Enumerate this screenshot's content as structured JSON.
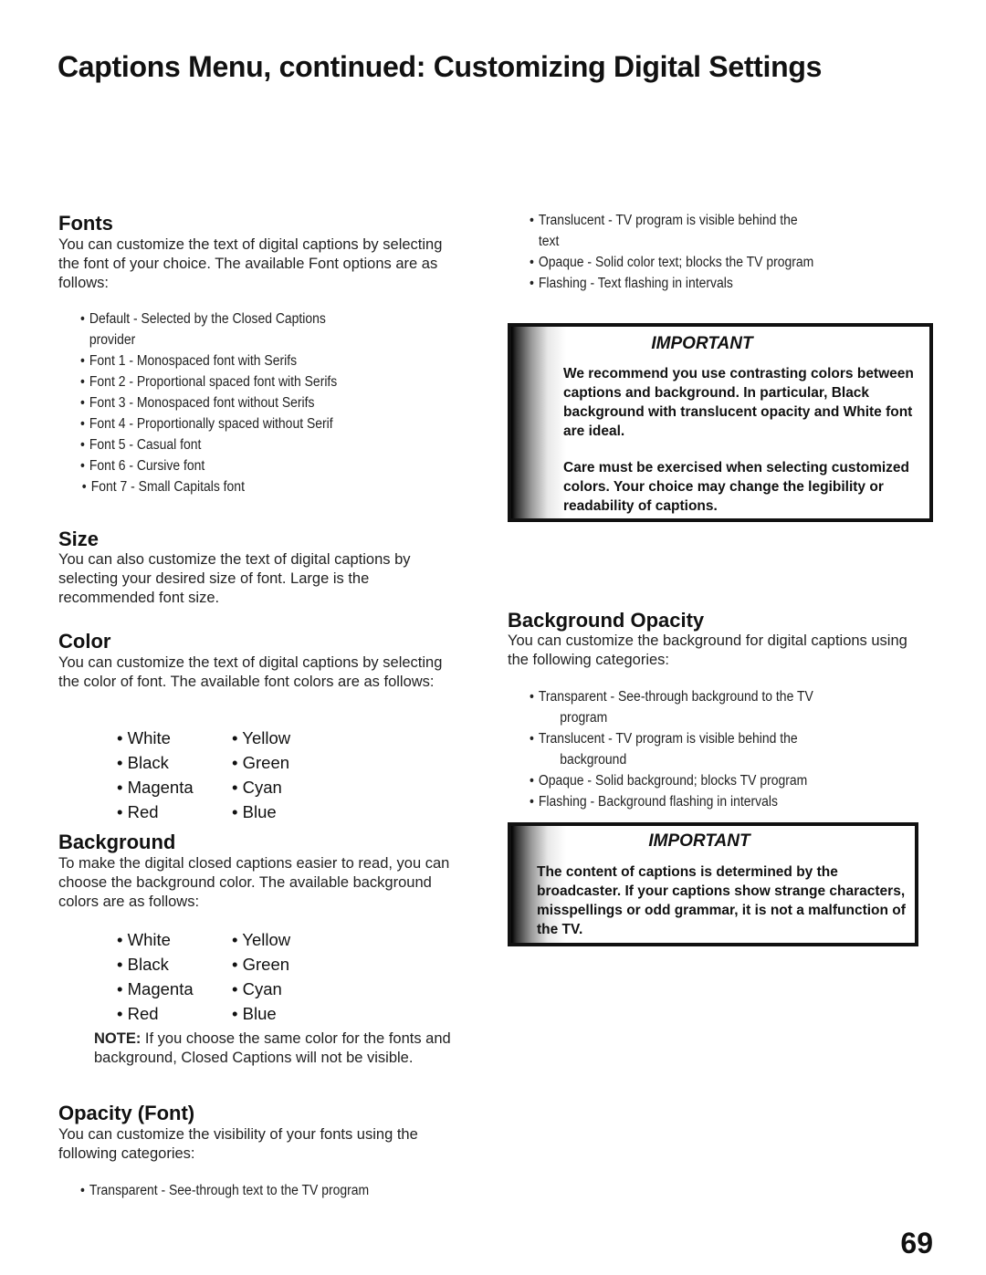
{
  "page_title": "Captions Menu, continued: Customizing Digital Settings",
  "page_number": "69",
  "left": {
    "fonts": {
      "heading": "Fonts",
      "intro": "You can customize the text of digital captions by selecting the font of your choice.  The available Font options are as follows:",
      "items": [
        {
          "text": "Default - Selected by the Closed Captions",
          "cont": "provider"
        },
        {
          "text": "Font 1 - Monospaced font with Serifs"
        },
        {
          "text": "Font 2 - Proportional spaced font with Serifs"
        },
        {
          "text": "Font 3 - Monospaced font without Serifs"
        },
        {
          "text": "Font 4 - Proportionally spaced without Serif"
        },
        {
          "text": "Font 5 - Casual font"
        },
        {
          "text": "Font 6 - Cursive font"
        },
        {
          "text": "Font 7 - Small Capitals font"
        }
      ]
    },
    "size": {
      "heading": "Size",
      "text": "You can also customize the text of digital captions by selecting your desired size of font.  Large is the recommended font size."
    },
    "color": {
      "heading": "Color",
      "intro": "You can customize the text of digital captions by selecting the color of font.  The available font colors are as follows:",
      "options": [
        "White",
        "Yellow",
        "Black",
        "Green",
        "Magenta",
        "Cyan",
        "Red",
        "Blue"
      ]
    },
    "background": {
      "heading": "Background",
      "intro": "To make the digital closed captions easier to read, you can choose the background color.  The available background colors are as follows:",
      "options": [
        "White",
        "Yellow",
        "Black",
        "Green",
        "Magenta",
        "Cyan",
        "Red",
        "Blue"
      ],
      "note_label": "NOTE:",
      "note_text": "  If you choose the same color for the fonts and background, Closed Captions will not be visible."
    },
    "opacity_font": {
      "heading": "Opacity (Font)",
      "intro": "You can customize the visibility of your fonts using the following categories:",
      "items": [
        {
          "text": "Transparent - See-through text to the TV program"
        }
      ]
    }
  },
  "right": {
    "opacity_font_cont": {
      "items": [
        {
          "text": "Translucent - TV program is visible behind the",
          "cont": "text"
        },
        {
          "text": "Opaque - Solid color text; blocks the TV program"
        },
        {
          "text": "Flashing - Text flashing in intervals"
        }
      ]
    },
    "important1": {
      "title": "IMPORTANT",
      "para1": "We recommend you use contrasting colors between captions and background.  In particular, Black background with translucent opacity and White font are ideal.",
      "para2": "Care must be exercised when selecting customized colors.  Your choice may change the legibility or readability of captions."
    },
    "bg_opacity": {
      "heading": "Background Opacity",
      "intro": "You can customize the background for digital captions using the following categories:",
      "items": [
        {
          "text": "Transparent - See-through background to the TV",
          "cont": "program"
        },
        {
          "text": "Translucent -  TV program is visible behind the",
          "cont": "background"
        },
        {
          "text": "Opaque - Solid background; blocks TV program"
        },
        {
          "text": "Flashing - Background flashing in intervals"
        }
      ]
    },
    "important2": {
      "title": "IMPORTANT",
      "para1": "The content of captions is determined by the broadcaster.  If your captions show strange characters, misspellings or odd grammar, it is not a malfunction of the TV."
    }
  }
}
